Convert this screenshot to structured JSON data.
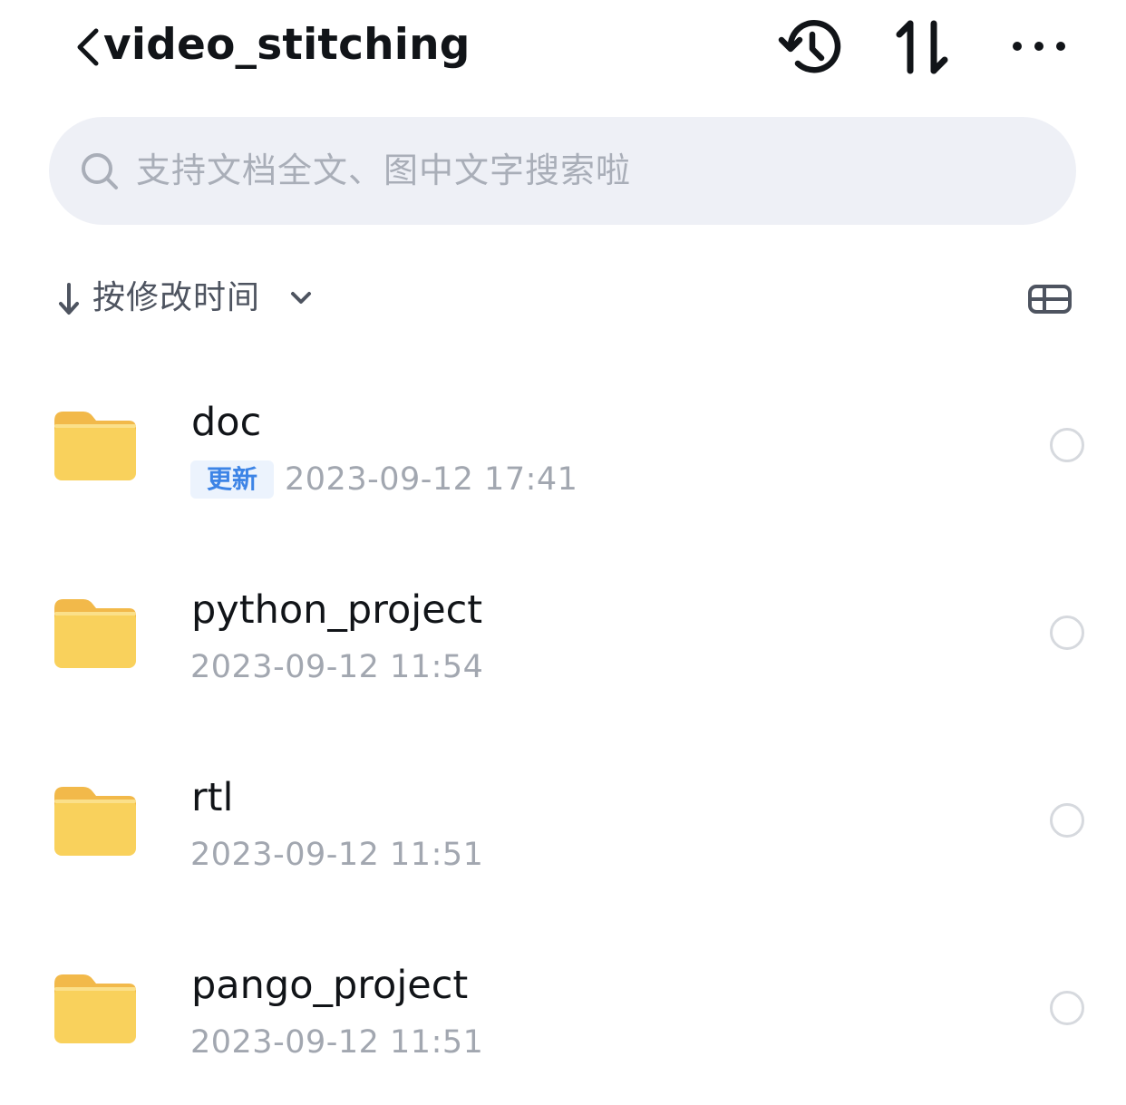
{
  "header": {
    "title": "video_stitching",
    "icons": {
      "back": "chevron-left-icon",
      "history": "history-icon",
      "sort": "sort-arrows-icon",
      "more": "more-dots-icon"
    }
  },
  "search": {
    "placeholder": "支持文档全文、图中文字搜索啦",
    "icon": "search-icon"
  },
  "sort": {
    "direction_icon": "arrow-down-icon",
    "label": "按修改时间",
    "chevron_icon": "chevron-down-icon",
    "view_toggle_icon": "view-toggle-icon"
  },
  "files": [
    {
      "name": "doc",
      "badge": "更新",
      "time": "2023-09-12 17:41"
    },
    {
      "name": "python_project",
      "badge": "",
      "time": "2023-09-12 11:54"
    },
    {
      "name": "rtl",
      "badge": "",
      "time": "2023-09-12 11:51"
    },
    {
      "name": "pango_project",
      "badge": "",
      "time": "2023-09-12 11:51"
    }
  ],
  "colors": {
    "folder": "#f9d15c",
    "folder_tab": "#f2b94a",
    "badge_text": "#3d84e6",
    "badge_bg": "#ecf3fd",
    "search_bg": "#eef0f6",
    "secondary_text": "#a2a7b0"
  }
}
